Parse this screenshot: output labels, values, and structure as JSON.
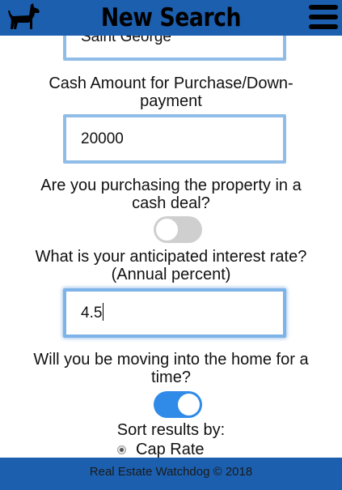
{
  "header": {
    "title": "New Search",
    "logo_icon": "dog-icon",
    "menu_icon": "hamburger-menu-icon"
  },
  "form": {
    "city": {
      "value": "Saint George"
    },
    "cash_amount": {
      "label": "Cash Amount for Purchase/Down-payment",
      "label_line1": "Cash Amount for Purchase/Down-",
      "label_line2": "payment",
      "value": "20000"
    },
    "cash_deal": {
      "label_line1": "Are you purchasing the property in a",
      "label_line2": "cash deal?",
      "checked": false
    },
    "interest_rate": {
      "label_line1": "What is your anticipated interest rate?",
      "label_line2": "(Annual percent)",
      "value": "4.5"
    },
    "move_in": {
      "label_line1": "Will you be moving into the home for a",
      "label_line2": "time?",
      "checked": true
    },
    "sort": {
      "label": "Sort results by:",
      "selected": "Cap Rate",
      "options": [
        "Cap Rate"
      ]
    }
  },
  "footer": {
    "text": "Real Estate Watchdog © 2018"
  },
  "colors": {
    "brand": "#1b5fae",
    "field_border": "#8fbde8",
    "toggle_on": "#2f8ae8",
    "toggle_off": "#cfcfcf"
  }
}
